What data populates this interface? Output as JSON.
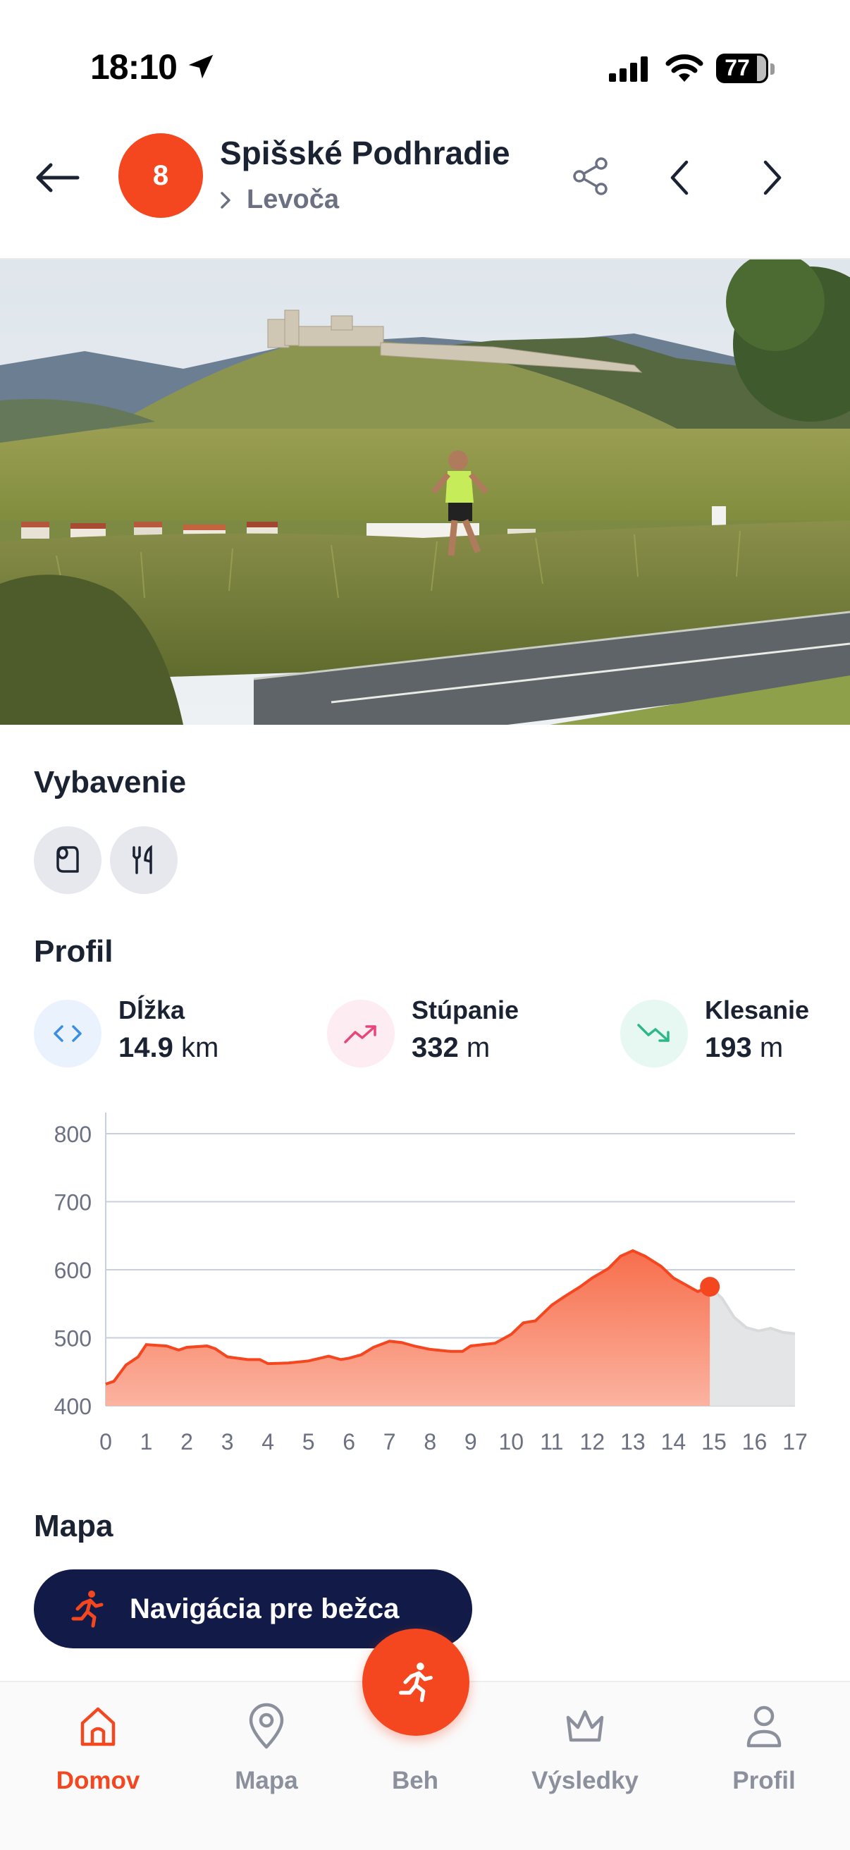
{
  "status_bar": {
    "time": "18:10",
    "battery": "77"
  },
  "header": {
    "stage_number": "8",
    "title": "Spišské Podhradie",
    "next_stage": "Levoča",
    "icons": {
      "back": "arrow-left-icon",
      "share": "share-icon",
      "prev": "chevron-left-icon",
      "next": "chevron-right-icon"
    }
  },
  "equipment": {
    "title": "Vybavenie",
    "items": [
      {
        "icon": "toilet-paper-icon"
      },
      {
        "icon": "fork-knife-icon"
      }
    ]
  },
  "profile": {
    "title": "Profil",
    "stats": [
      {
        "label": "Dĺžka",
        "value": "14.9",
        "unit": "km",
        "icon": "length-icon",
        "color": "#3a8ee6"
      },
      {
        "label": "Stúpanie",
        "value": "332",
        "unit": "m",
        "icon": "trend-up-icon",
        "color": "#e8457a"
      },
      {
        "label": "Klesanie",
        "value": "193",
        "unit": "m",
        "icon": "trend-down-icon",
        "color": "#2eb88a"
      }
    ]
  },
  "chart_data": {
    "type": "area",
    "xlabel": "",
    "ylabel": "",
    "xlim": [
      0,
      17
    ],
    "ylim": [
      400,
      800
    ],
    "x_ticks": [
      "0",
      "1",
      "2",
      "3",
      "4",
      "5",
      "6",
      "7",
      "8",
      "9",
      "10",
      "11",
      "12",
      "13",
      "14",
      "15",
      "17"
    ],
    "x_tick_values": [
      0,
      1,
      2,
      3,
      4,
      5,
      6,
      7,
      8,
      9,
      10,
      11,
      12,
      13,
      14,
      15,
      16,
      17
    ],
    "x_tick_labels": [
      "0",
      "1",
      "2",
      "3",
      "4",
      "5",
      "6",
      "7",
      "8",
      "9",
      "10",
      "11",
      "12",
      "13",
      "14",
      "15",
      "16",
      "17"
    ],
    "y_ticks": [
      400,
      500,
      600,
      700,
      800
    ],
    "grid": true,
    "highlight_end_km": 14.9,
    "highlight_color": "#f4461f",
    "rest_color": "#d9dadc",
    "series": [
      {
        "x": [
          0,
          0.2,
          0.5,
          0.8,
          1.0,
          1.5,
          1.8,
          2.0,
          2.5,
          2.7,
          3.0,
          3.5,
          3.8,
          4.0,
          4.5,
          5.0,
          5.5,
          5.8,
          6.0,
          6.3,
          6.6,
          7.0,
          7.3,
          7.6,
          8.0,
          8.5,
          8.8,
          9.0,
          9.3,
          9.6,
          10.0,
          10.3,
          10.6,
          11.0,
          11.3,
          11.7,
          12.0,
          12.4,
          12.7,
          13.0,
          13.3,
          13.7,
          14.0,
          14.3,
          14.6,
          14.9,
          15.2,
          15.5,
          15.8,
          16.1,
          16.4,
          16.7,
          17.0
        ],
        "y": [
          432,
          436,
          460,
          472,
          490,
          488,
          482,
          486,
          488,
          484,
          472,
          468,
          468,
          462,
          463,
          466,
          473,
          468,
          470,
          475,
          486,
          495,
          493,
          488,
          483,
          480,
          480,
          488,
          490,
          492,
          505,
          522,
          525,
          548,
          560,
          575,
          588,
          602,
          620,
          628,
          620,
          605,
          588,
          578,
          568,
          575,
          558,
          530,
          515,
          510,
          514,
          508,
          506
        ]
      }
    ]
  },
  "map": {
    "title": "Mapa",
    "nav_button": "Navigácia pre bežca"
  },
  "tabs": [
    {
      "label": "Domov",
      "icon": "home-icon",
      "active": true
    },
    {
      "label": "Mapa",
      "icon": "map-pin-icon",
      "active": false
    },
    {
      "label": "Beh",
      "icon": "runner-icon",
      "active": false
    },
    {
      "label": "Výsledky",
      "icon": "crown-icon",
      "active": false
    },
    {
      "label": "Profil",
      "icon": "user-icon",
      "active": false
    }
  ]
}
